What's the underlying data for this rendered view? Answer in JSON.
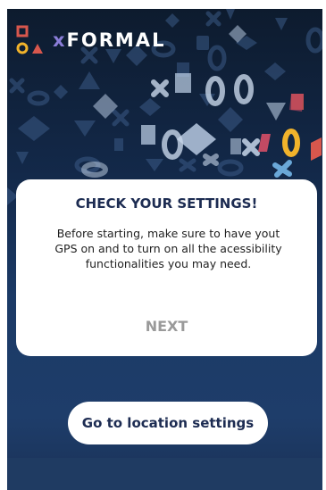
{
  "app": {
    "logo_text": "FORMAL",
    "logo_prefix": "x"
  },
  "dialog": {
    "title": "CHECK YOUR SETTINGS!",
    "body": "Before starting, make sure to have yout GPS on and to turn on all the acessibility functionalities you may need.",
    "next_label": "NEXT"
  },
  "location_button": {
    "label": "Go to location settings"
  },
  "colors": {
    "accent_red": "#d8574d",
    "accent_yellow": "#f1b32b",
    "accent_purple": "#8a7dd8",
    "accent_blue": "#6aa8d8",
    "navy": "#1d2c52"
  }
}
